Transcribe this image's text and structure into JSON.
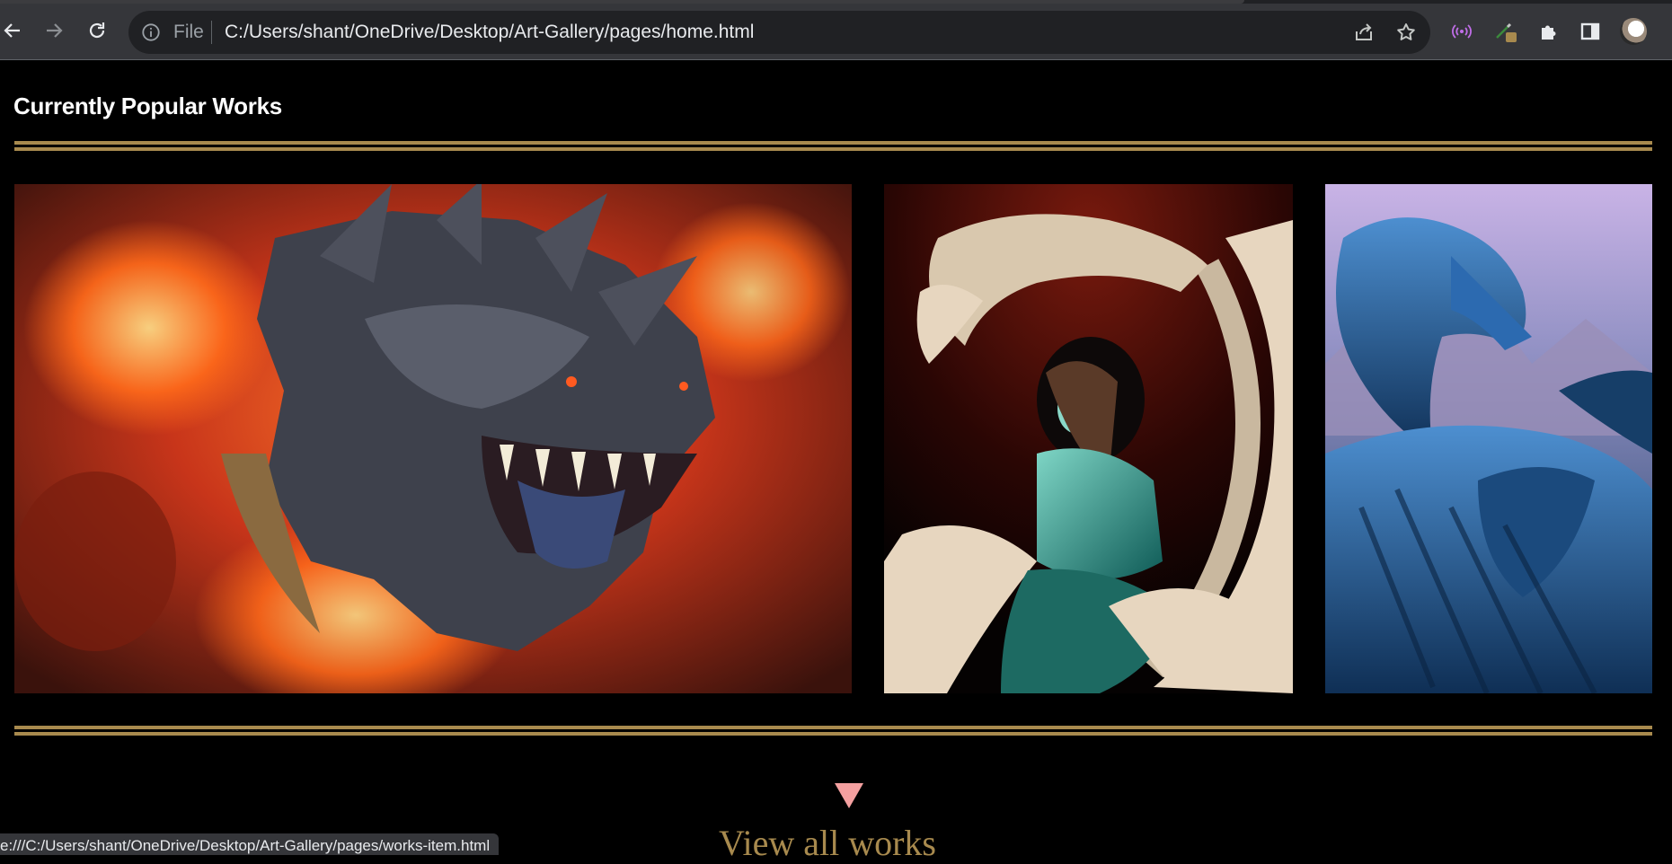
{
  "browser": {
    "nav": {
      "back_icon": "arrow-left-icon",
      "forward_icon": "arrow-right-icon",
      "reload_icon": "reload-icon"
    },
    "address_bar": {
      "scheme_label": "File",
      "url": "C:/Users/shant/OneDrive/Desktop/Art-Gallery/pages/home.html",
      "info_icon": "info-icon",
      "share_icon": "share-icon",
      "bookmark_icon": "star-icon"
    },
    "extensions": [
      "radio-waves-icon",
      "eyedropper-icon",
      "puzzle-piece-icon",
      "side-panel-icon",
      "profile-avatar"
    ],
    "status_bar": "e:///C:/Users/shant/OneDrive/Desktop/Art-Gallery/pages/works-item.html"
  },
  "page": {
    "section_title": "Currently Popular Works",
    "rule_color": "#a88a4e",
    "works": [
      {
        "name": "fire-dragon-artwork",
        "palette": [
          "#e2421a",
          "#3c3e48"
        ]
      },
      {
        "name": "dragon-and-woman-artwork",
        "palette": [
          "#5a130a",
          "#e7d6bf"
        ]
      },
      {
        "name": "blue-dragon-artwork",
        "palette": [
          "#b8a5d6",
          "#1f4d7d"
        ]
      }
    ],
    "view_all": {
      "arrow_icon": "triangle-down-icon",
      "arrow_color": "#f4a0a0",
      "label": "View all works",
      "label_color": "#a88a4e"
    }
  }
}
